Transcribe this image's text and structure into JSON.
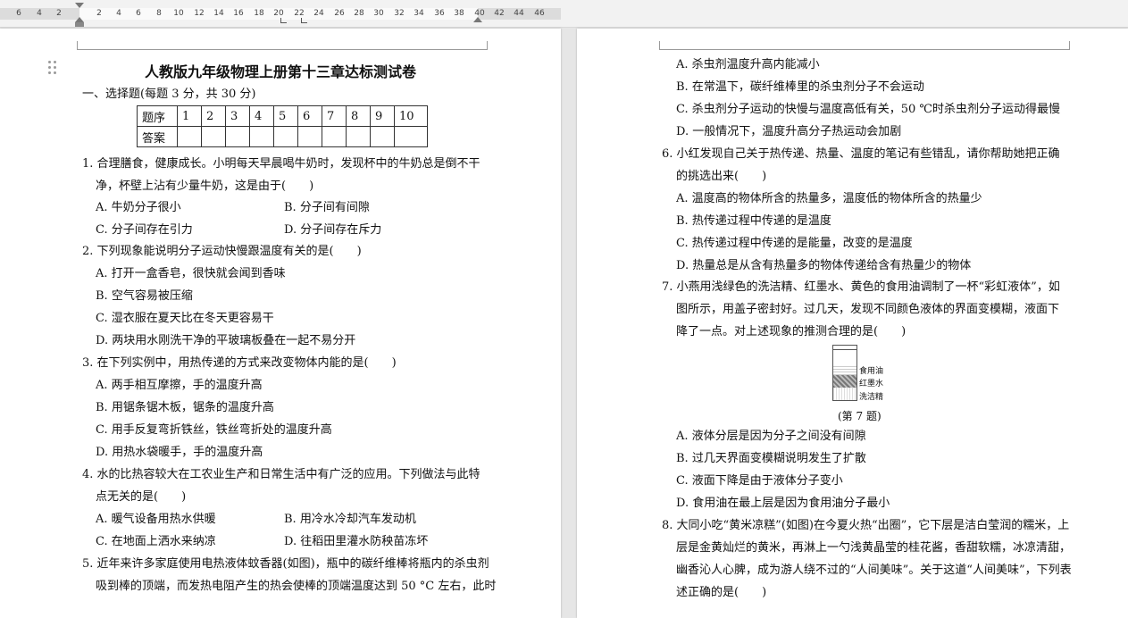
{
  "ruler": {
    "ticks": [
      "6",
      "4",
      "2",
      "2",
      "4",
      "6",
      "8",
      "10",
      "12",
      "14",
      "16",
      "18",
      "20",
      "22",
      "24",
      "26",
      "28",
      "30",
      "32",
      "34",
      "36",
      "38",
      "40",
      "42",
      "44",
      "46"
    ]
  },
  "doc": {
    "title": "人教版九年级物理上册第十三章达标测试卷",
    "section": "一、选择题(每题 3 分，共 30 分)",
    "table": {
      "row1_head": "题序",
      "row2_head": "答案",
      "numbers": [
        "1",
        "2",
        "3",
        "4",
        "5",
        "6",
        "7",
        "8",
        "9",
        "10"
      ]
    },
    "left_lines": [
      "1. 合理膳食，健康成长。小明每天早晨喝牛奶时，发现杯中的牛奶总是倒不干",
      "净，杯壁上沾有少量牛奶，这是由于(　　)",
      "A. 牛奶分子很小",
      "B. 分子间有间隙",
      "C. 分子间存在引力",
      "D. 分子间存在斥力",
      "2. 下列现象能说明分子运动快慢跟温度有关的是(　　)",
      "A. 打开一盒香皂，很快就会闻到香味",
      "B. 空气容易被压缩",
      "C. 湿衣服在夏天比在冬天更容易干",
      "D. 两块用水刚洗干净的平玻璃板叠在一起不易分开",
      "3. 在下列实例中，用热传递的方式来改变物体内能的是(　　)",
      "A. 两手相互摩擦，手的温度升高",
      "B. 用锯条锯木板，锯条的温度升高",
      "C. 用手反复弯折铁丝，铁丝弯折处的温度升高",
      "D. 用热水袋暖手，手的温度升高",
      "4. 水的比热容较大在工农业生产和日常生活中有广泛的应用。下列做法与此特",
      "点无关的是(　　)",
      "A. 暖气设备用热水供暖",
      "B. 用冷水冷却汽车发动机",
      "C. 在地面上洒水来纳凉",
      "D. 往稻田里灌水防秧苗冻坏",
      "5. 近年来许多家庭使用电热液体蚊香器(如图)，瓶中的碳纤维棒将瓶内的杀虫剂",
      "吸到棒的顶端，而发热电阻产生的热会使棒的顶端温度达到 50 °C 左右，此时"
    ],
    "right_lines": [
      "A. 杀虫剂温度升高内能减小",
      "B. 在常温下，碳纤维棒里的杀虫剂分子不会运动",
      "C. 杀虫剂分子运动的快慢与温度高低有关，50 ℃时杀虫剂分子运动得最慢",
      "D. 一般情况下，温度升高分子热运动会加剧",
      "6. 小红发现自己关于热传递、热量、温度的笔记有些错乱，请你帮助她把正确",
      "的挑选出来(　　)",
      "A. 温度高的物体所含的热量多，温度低的物体所含的热量少",
      "B. 热传递过程中传递的是温度",
      "C. 热传递过程中传递的是能量，改变的是温度",
      "D. 热量总是从含有热量多的物体传递给含有热量少的物体",
      "7. 小燕用浅绿色的洗洁精、红墨水、黄色的食用油调制了一杯“彩虹液体”，如",
      "图所示，用盖子密封好。过几天，发现不同颜色液体的界面变模糊，液面下",
      "降了一点。对上述现象的推测合理的是(　　)",
      "A. 液体分层是因为分子之间没有间隙",
      "B. 过几天界面变模糊说明发生了扩散",
      "C. 液面下降是由于液体分子变小",
      "D. 食用油在最上层是因为食用油分子最小",
      "8. 大同小吃“黄米凉糕”(如图)在今夏火热“出圈”，它下层是洁白莹润的糯米，上",
      "层是金黄灿烂的黄米，再淋上一勺浅黄晶莹的桂花酱，香甜软糯，冰凉清甜，",
      "幽香沁人心脾，成为游人绕不过的“人间美味”。关于这道“人间美味”，下列表",
      "述正确的是(　　)"
    ],
    "figure7": {
      "labels": [
        "食用油",
        "红墨水",
        "洗洁精"
      ],
      "caption": "(第 7 题)"
    }
  }
}
